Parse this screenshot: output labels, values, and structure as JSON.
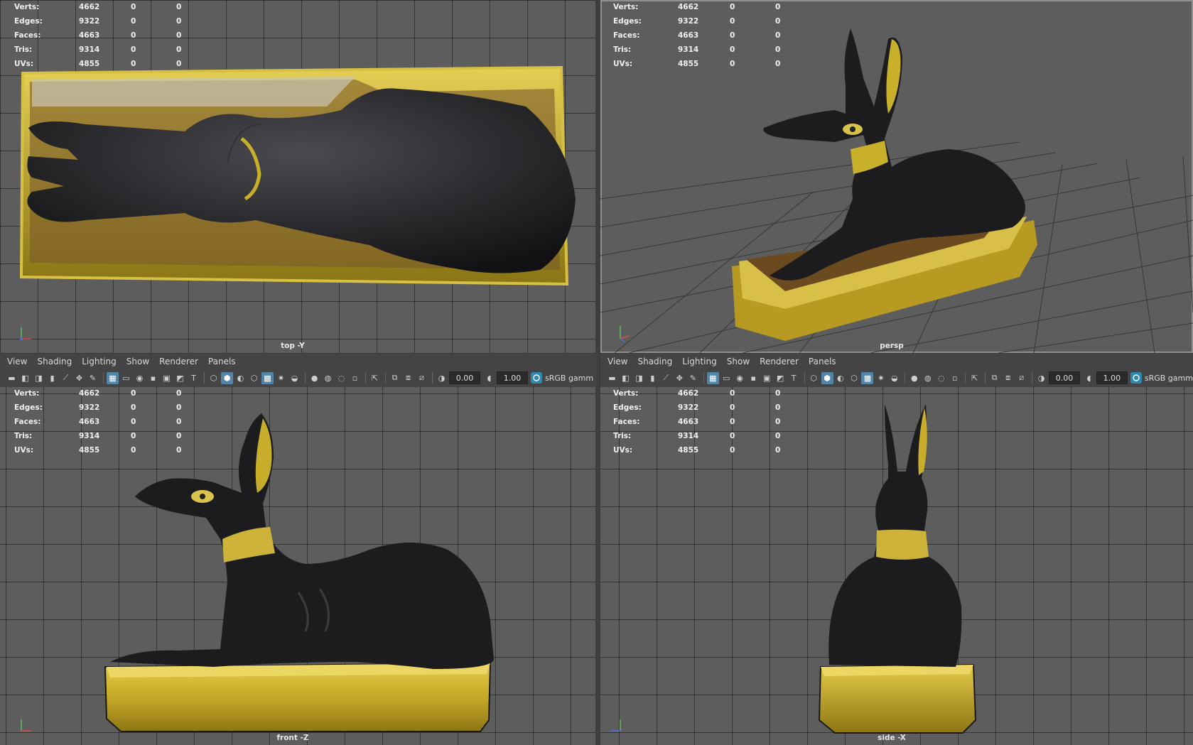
{
  "stats_labels": [
    "Verts:",
    "Edges:",
    "Faces:",
    "Tris:",
    "UVs:"
  ],
  "stats_rows": [
    [
      "4662",
      "0",
      "0"
    ],
    [
      "9322",
      "0",
      "0"
    ],
    [
      "4663",
      "0",
      "0"
    ],
    [
      "9314",
      "0",
      "0"
    ],
    [
      "4855",
      "0",
      "0"
    ]
  ],
  "viewports": {
    "top": {
      "camera": "top -Y"
    },
    "persp": {
      "camera": "persp"
    },
    "front": {
      "camera": "front -Z"
    },
    "side": {
      "camera": "side -X"
    }
  },
  "panel_menu": [
    "View",
    "Shading",
    "Lighting",
    "Show",
    "Renderer",
    "Panels"
  ],
  "toolbar": {
    "exposure": "0.00",
    "gamma": "1.00",
    "color_space": "sRGB gamm"
  },
  "colors": {
    "viewport_bg": "#5d5d5d",
    "grid_line": "#333333",
    "gold": "#c9b02a",
    "black_statue": "#1b1b1e",
    "highlight_blue": "#5285a6"
  },
  "icons": [
    "camera-icon",
    "bookmark-icon",
    "grid-icon",
    "wireframe-icon",
    "smooth-shade-icon",
    "texture-icon",
    "light-icon",
    "xray-icon",
    "isolate-icon",
    "color-space-icon"
  ]
}
